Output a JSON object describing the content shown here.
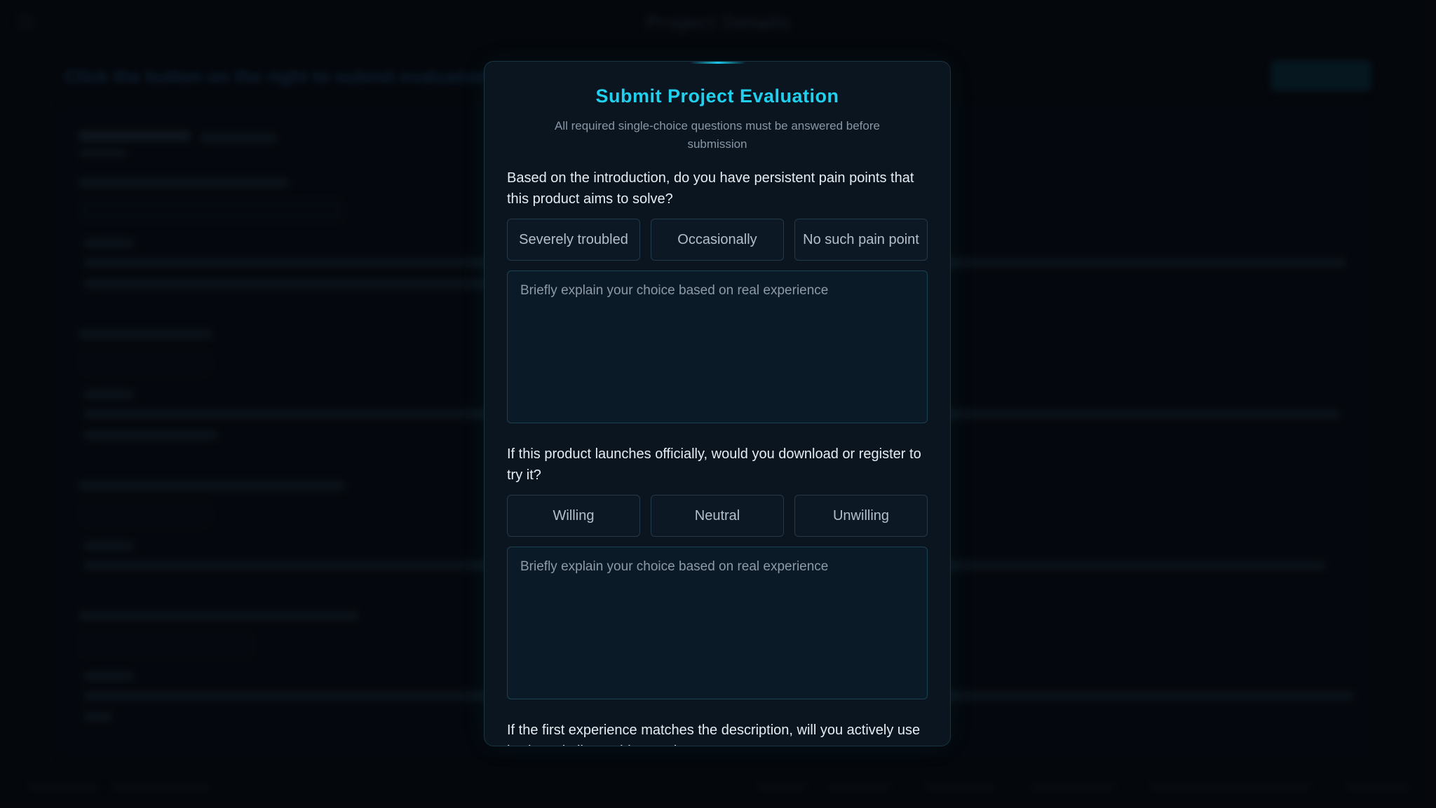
{
  "background": {
    "app_title": "Project Details",
    "instruction": "Click the button on the right to submit evaluation"
  },
  "modal": {
    "title": "Submit Project Evaluation",
    "subtitle": "All required single-choice questions must be answered before submission",
    "questions": [
      {
        "text": "Based on the introduction, do you have persistent pain points that this product aims to solve?",
        "options": [
          "Severely troubled",
          "Occasionally",
          "No such pain point"
        ],
        "answer_placeholder": "Briefly explain your choice based on real experience"
      },
      {
        "text": "If this product launches officially, would you download or register to try it?",
        "options": [
          "Willing",
          "Neutral",
          "Unwilling"
        ],
        "answer_placeholder": "Briefly explain your choice based on real experience"
      },
      {
        "text": "If the first experience matches the description, will you actively use it when similar problems arise?"
      }
    ]
  },
  "colors": {
    "accent": "#1fd0ef",
    "modal_bg": "#0b151f",
    "page_bg": "#070b12"
  }
}
